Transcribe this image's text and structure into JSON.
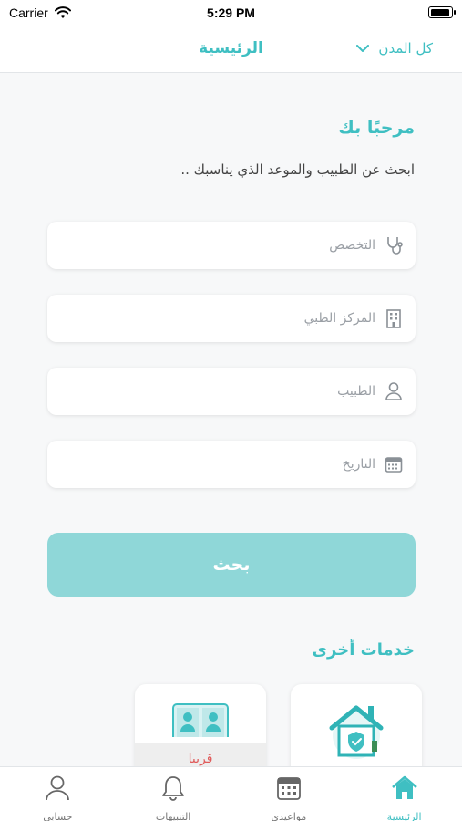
{
  "status_bar": {
    "carrier": "Carrier",
    "time": "5:29 PM"
  },
  "nav": {
    "title": "الرئيسية",
    "city_filter": "كل المدن"
  },
  "welcome": {
    "title": "مرحبًا بك",
    "subtitle": "ابحث عن الطبيب والموعد الذي يناسبك .."
  },
  "form": {
    "specialty_placeholder": "التخصص",
    "center_placeholder": "المركز الطبي",
    "doctor_placeholder": "الطبيب",
    "date_placeholder": "التاريخ",
    "search_label": "بحث"
  },
  "services": {
    "title": "خدمات أخرى",
    "cards": [
      {
        "icon": "home-care-icon",
        "badge": ""
      },
      {
        "icon": "video-consult-icon",
        "badge": "قريبا"
      }
    ]
  },
  "tabs": [
    {
      "label": "الرئيسية",
      "icon": "home-icon",
      "active": true
    },
    {
      "label": "مواعيدي",
      "icon": "calendar-icon",
      "active": false
    },
    {
      "label": "التنبيهات",
      "icon": "bell-icon",
      "active": false
    },
    {
      "label": "حسابي",
      "icon": "user-icon",
      "active": false
    }
  ],
  "colors": {
    "accent": "#3fbfc2",
    "button": "#8fd7d8",
    "soon": "#e05a5a"
  }
}
